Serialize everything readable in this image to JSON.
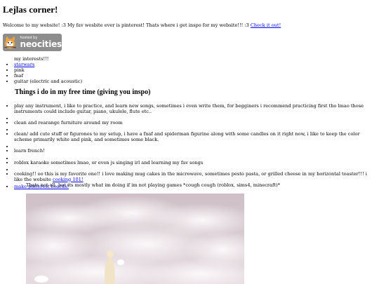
{
  "title": "Lejlas corner!",
  "welcome": {
    "text": "Welcome to my website! :3 My fav wesbite ever is pinterest! Thats where i get inspo for my website!!! :3 ",
    "link": "Check it out!"
  },
  "badge": {
    "top": "hosted by",
    "brand": "neocities"
  },
  "interests": {
    "heading": "my interests!!!",
    "items": [
      "starwars",
      "pink",
      "fnaf",
      "guitar (electric and acoustic)"
    ]
  },
  "section_title": "Things i do in my free time (giving you inspo)",
  "activities": [
    "play any instrument, i like to practice, and learn new songs, sometimes i even write them, for begginers i recommend practicing first tho lmao those instruments could include guitar, piano, ukulele, flute etc..",
    "",
    "clean and rearange furniture around my room",
    "",
    "clean/ add cute stuff or figurones to my setup, i have a fnaf and spiderman figurine along with some candles on it right now, i like to keep the color scheme primarily white and pink, and sometimes some black.",
    "",
    "learn french!",
    "",
    "roblox karaoke sometimes lmao, or even js singing irl and learning my fav songs",
    "",
    "cooking!! oo this is my favorite one!! i love making mug cakes in the microwave, sometimes pesto pasta, or grilled cheese in my horizontal toaster!!! i like the website "
  ],
  "cooking_link": "cooking 101!",
  "pinterest_link": "make pinterest boards!",
  "note": "Thats not all, but its mostly what im doing if im not playing games *cough cough (roblox, sims4, minecraft)*",
  "colors": {
    "link": "#0000ee",
    "badge_bg": "#8d8d8d",
    "sky": "#d8cbd0"
  }
}
